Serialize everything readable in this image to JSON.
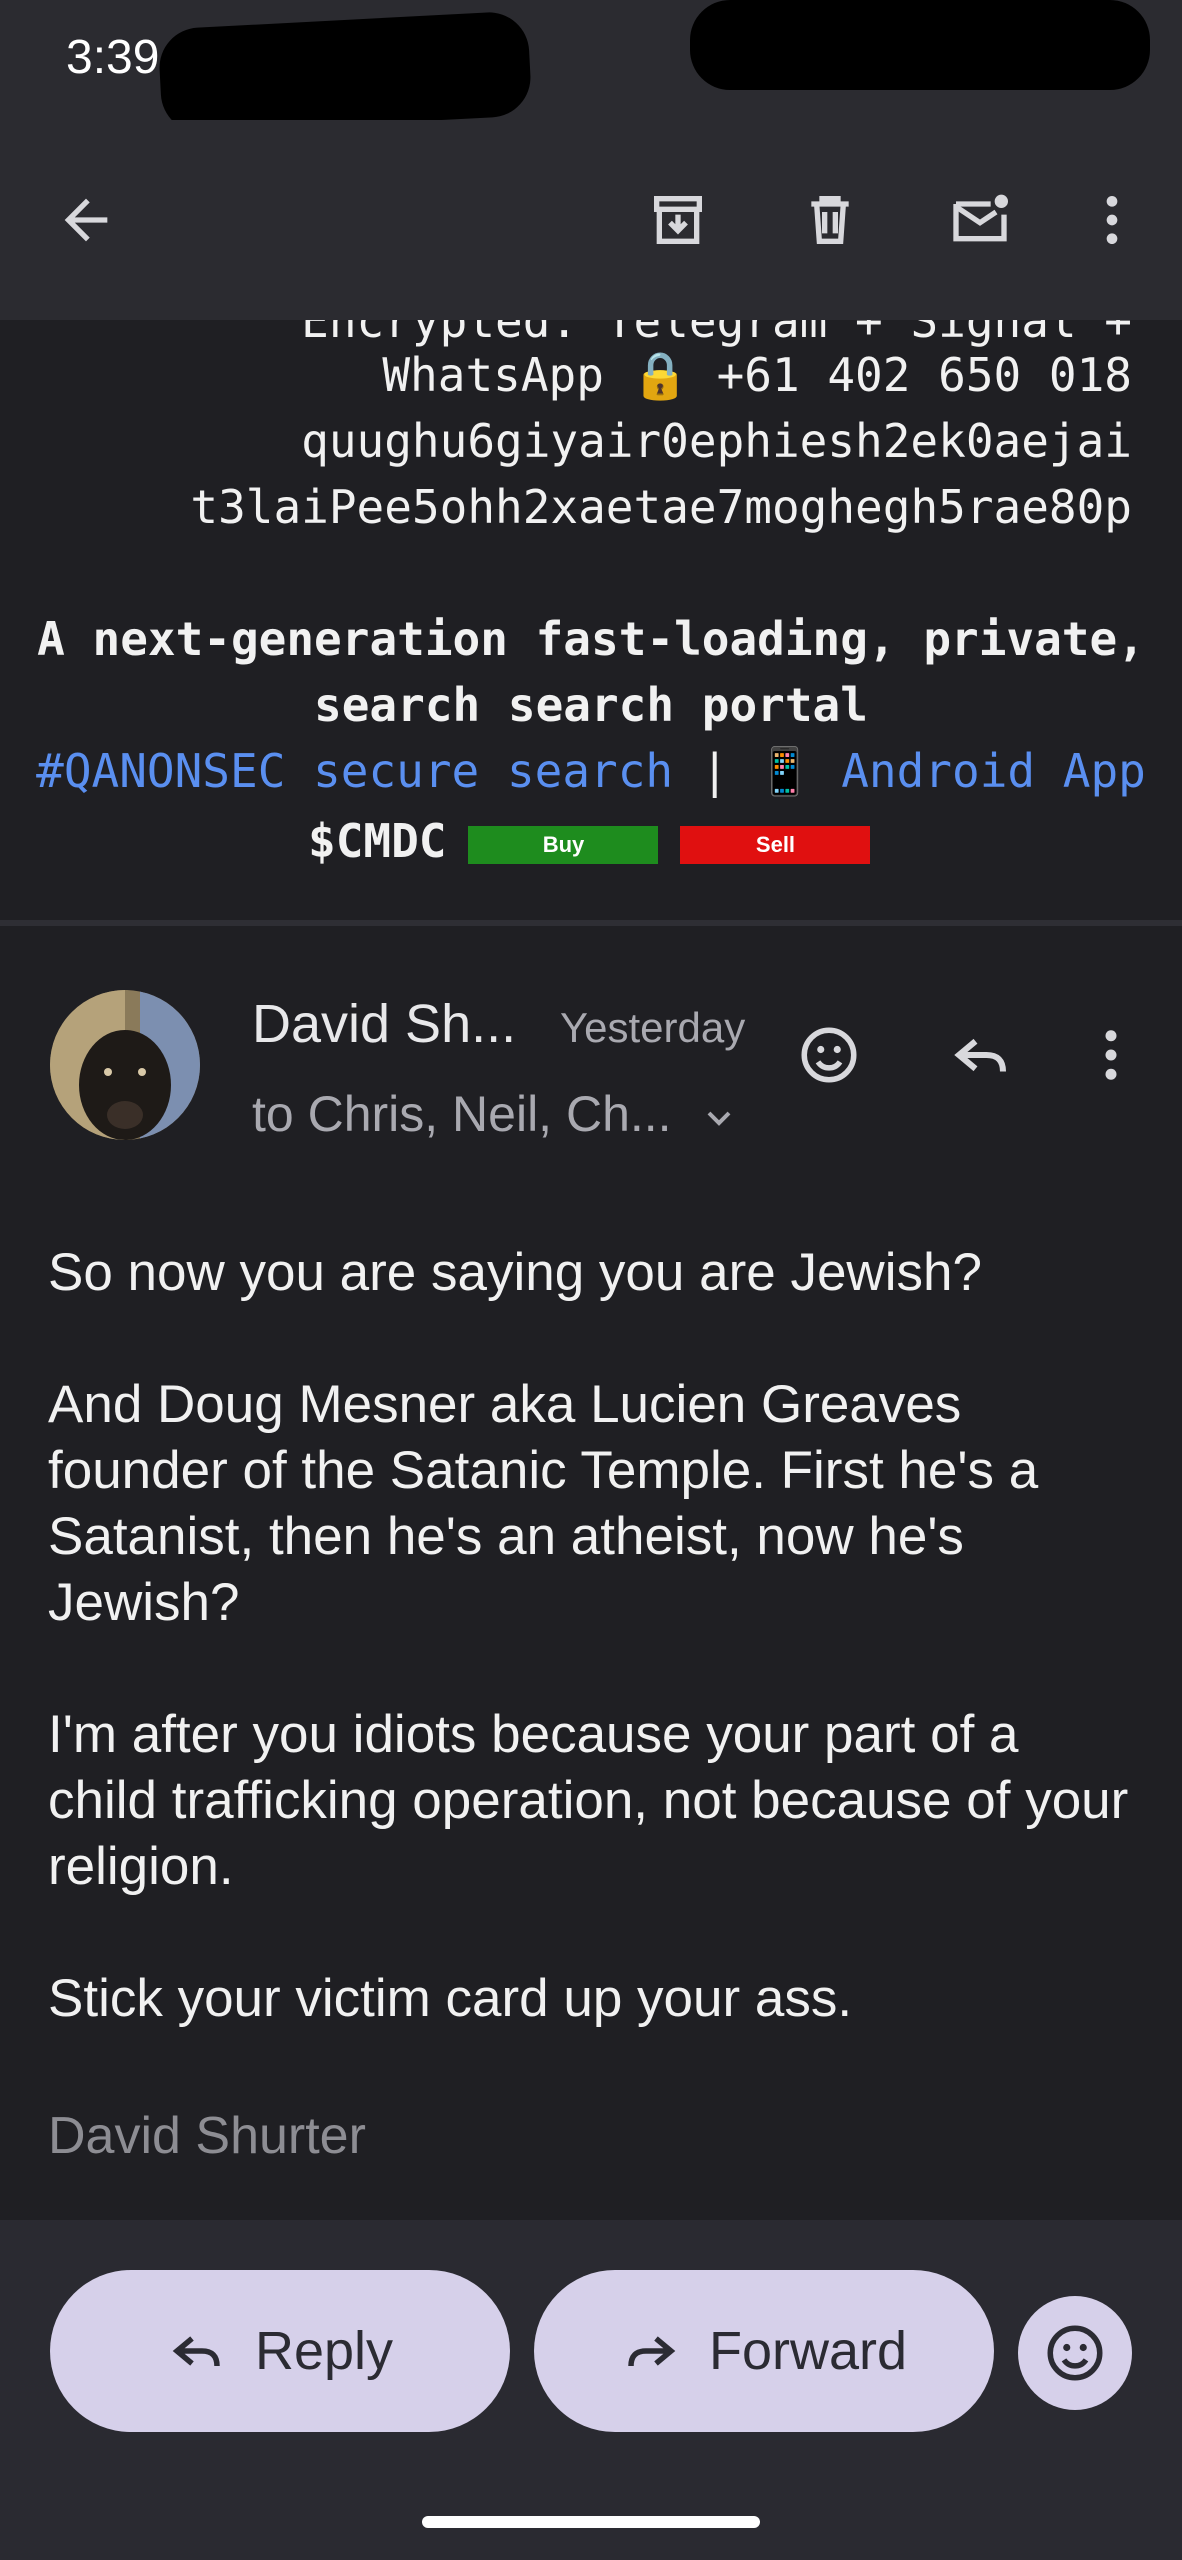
{
  "status_bar": {
    "time": "3:39"
  },
  "toolbar": {
    "icons": [
      "back-arrow-icon",
      "archive-icon",
      "delete-icon",
      "mark-unread-icon",
      "more-vert-icon"
    ]
  },
  "signature_block": {
    "partial_line": "Encrypted: Telegram + Signal +",
    "whatsapp_line": "WhatsApp 🔒 +61 402 650 018",
    "key_line_1": "quughu6giyair0ephiesh2ek0aejai",
    "key_line_2": "t3laiPee5ohh2xaetae7moghegh5rae80p",
    "tagline_1": "A next-generation fast-loading, private,",
    "tagline_2": "search search portal",
    "link_search": "#QANONSEC secure search",
    "separator": "|",
    "phone_emoji": "📱",
    "link_app": "Android App",
    "ticker": "$CMDC",
    "buy_label": "Buy",
    "sell_label": "Sell",
    "buy_color": "#1e8c1e",
    "sell_color": "#e01010"
  },
  "message": {
    "sender": "David Sh...",
    "time": "Yesterday",
    "recipients": "to Chris, Neil, Ch...",
    "paragraphs": [
      "So now you are saying you are Jewish?",
      "And Doug Mesner aka Lucien Greaves founder of the Satanic Temple. First he's a Satanist, then he's an atheist, now he's Jewish?",
      "I'm after you idiots because your part of a child trafficking operation, not because of your religion.",
      "Stick your victim card up your ass."
    ],
    "signature": "David Shurter"
  },
  "actions": {
    "reply_label": "Reply",
    "forward_label": "Forward"
  },
  "colors": {
    "background": "#1f1f23",
    "bar": "#2b2b30",
    "pill": "#d6d0ea",
    "link": "#5a8ff0"
  }
}
